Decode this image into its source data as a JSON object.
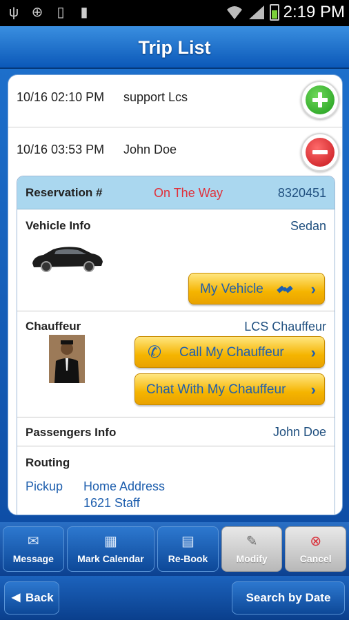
{
  "status_bar": {
    "time": "2:19 PM",
    "icons": [
      "usb-icon",
      "gps-icon",
      "sd-card-icon",
      "phone-icon",
      "wifi-icon",
      "signal-icon",
      "battery-icon"
    ]
  },
  "title": "Trip List",
  "trips": [
    {
      "datetime": "10/16 02:10 PM",
      "name": "support Lcs",
      "action_icon": "add-icon"
    },
    {
      "datetime": "10/16 03:53 PM",
      "name": "John Doe",
      "action_icon": "remove-icon"
    }
  ],
  "reservation": {
    "label": "Reservation #",
    "status": "On The Way",
    "number": "8320451",
    "vehicle": {
      "title": "Vehicle Info",
      "value": "Sedan",
      "button": "My Vehicle"
    },
    "chauffeur": {
      "title": "Chauffeur",
      "value": "LCS Chauffeur",
      "call_button": "Call My Chauffeur",
      "chat_button": "Chat With My Chauffeur"
    },
    "passengers": {
      "title": "Passengers Info",
      "value": "John Doe"
    },
    "routing": {
      "title": "Routing",
      "pickup_label": "Pickup",
      "pickup_line1": "Home Address",
      "pickup_line2": "1621 Staff"
    }
  },
  "toolbar": {
    "message": "Message",
    "mark_calendar": "Mark Calendar",
    "rebook": "Re-Book",
    "modify": "Modify",
    "cancel": "Cancel"
  },
  "footer": {
    "back": "Back",
    "search_by_date": "Search by Date"
  },
  "colors": {
    "status": "#e0303a",
    "value_text": "#1f5fae",
    "header_blue": "#aad7ef",
    "accent_yellow": "#f5b400"
  }
}
